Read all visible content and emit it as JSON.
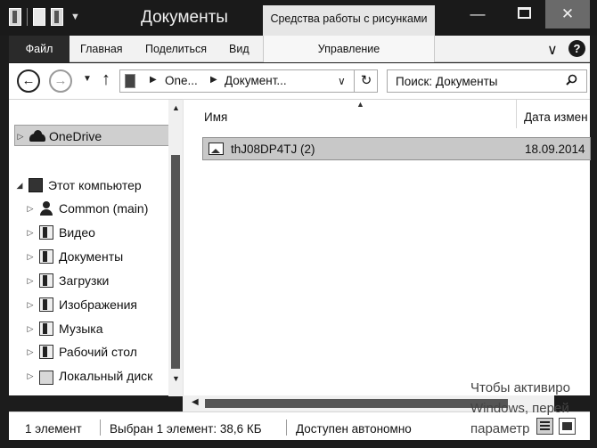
{
  "window": {
    "title": "Документы",
    "context_tab": "Средства работы с рисунками",
    "minimize": "—",
    "close": "✕"
  },
  "ribbon": {
    "tabs": [
      "Файл",
      "Главная",
      "Поделиться",
      "Вид",
      "Управление"
    ],
    "expand": "∨",
    "help": "?"
  },
  "address": {
    "back": "←",
    "forward": "→",
    "recent": "▼",
    "up": "↑",
    "crumbs": [
      "One...",
      "Документ..."
    ],
    "separator": "▶",
    "dropdown": "∨",
    "refresh": "↻",
    "search_placeholder": "Поиск: Документы"
  },
  "navigation": {
    "items": [
      {
        "label": "OneDrive",
        "expander": "▷",
        "icon": "cloud-icon",
        "selected": true
      },
      {
        "label": "Этот компьютер",
        "expander": "◢",
        "icon": "computer-icon"
      },
      {
        "label": "Common (main)",
        "expander": "▷",
        "icon": "user-icon"
      },
      {
        "label": "Видео",
        "expander": "▷",
        "icon": "folder-icon"
      },
      {
        "label": "Документы",
        "expander": "▷",
        "icon": "folder-icon"
      },
      {
        "label": "Загрузки",
        "expander": "▷",
        "icon": "folder-icon"
      },
      {
        "label": "Изображения",
        "expander": "▷",
        "icon": "folder-icon"
      },
      {
        "label": "Музыка",
        "expander": "▷",
        "icon": "folder-icon"
      },
      {
        "label": "Рабочий стол",
        "expander": "▷",
        "icon": "folder-icon"
      },
      {
        "label": "Локальный диск",
        "expander": "▷",
        "icon": "drive-icon"
      }
    ],
    "scroll_up": "▲",
    "scroll_down": "▼"
  },
  "content": {
    "sort_indicator": "▲",
    "columns": {
      "name": "Имя",
      "date": "Дата измен"
    },
    "files": [
      {
        "name": "thJ08DP4TJ (2)",
        "date": "18.09.2014",
        "icon": "image-file-icon",
        "selected": true
      }
    ],
    "hscroll_left": "◀"
  },
  "status": {
    "count": "1 элемент",
    "selection": "Выбран 1 элемент: 38,6 КБ",
    "availability": "Доступен автономно"
  },
  "watermark": {
    "line1": "Чтобы активиро",
    "line2": "Windows, перей",
    "line3": "параметр"
  }
}
